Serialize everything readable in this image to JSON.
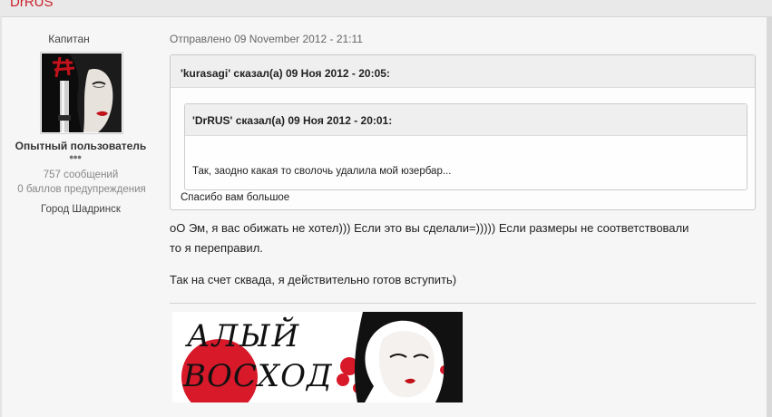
{
  "post": {
    "author_name": "DrRUS",
    "posted_line": "Отправлено 09 November 2012 - 21:11"
  },
  "user": {
    "rank_title": "Капитан",
    "group_name": "Опытный пользователь",
    "rank_pips": "●●●",
    "post_count": "757 сообщений",
    "warning_points": "0 баллов предупреждения",
    "city": "Город Шадринск"
  },
  "quote_outer": {
    "citation": "'kurasagi' сказал(а) 09 Ноя 2012 - 20:05:",
    "text": "Спасибо вам большое"
  },
  "quote_inner": {
    "citation": "'DrRUS' сказал(а) 09 Ноя 2012 - 20:01:",
    "text": "Так, заодно какая то сволочь удалила мой юзербар..."
  },
  "body": {
    "line1": "оО Эм, я вас обижать не хотел))) Если это вы сделали=))))) Если размеры не соответствовали",
    "line2": "то я переправил.",
    "line3": "Так на счет сквада, я действительно готов вступить)"
  },
  "signature": {
    "banner_text": "АЛЫЙ ВОСХОД"
  },
  "colors": {
    "author_red": "#c8212a",
    "banner_red": "#d7192a"
  },
  "icons": {
    "avatar": "geisha-avatar",
    "signature": "geisha-banner"
  }
}
